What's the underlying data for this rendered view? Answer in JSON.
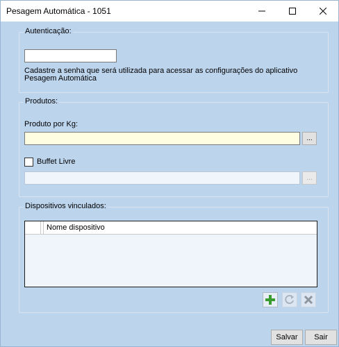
{
  "window": {
    "title": "Pesagem Automática - 1051"
  },
  "auth": {
    "group_label": "Autenticação:",
    "password_value": "",
    "hint": "Cadastre a senha que será utilizada para acessar as configurações do aplicativo Pesagem Automática"
  },
  "products": {
    "group_label": "Produtos:",
    "product_per_kg_label": "Produto por Kg:",
    "product_per_kg_value": "",
    "browse_label": "...",
    "buffet_label": "Buffet Livre",
    "buffet_checked": false,
    "buffet_value": "",
    "buffet_browse_label": "..."
  },
  "devices": {
    "group_label": "Dispositivos vinculados:",
    "columns": [
      "Nome dispositivo"
    ],
    "rows": []
  },
  "footer": {
    "save_label": "Salvar",
    "exit_label": "Sair"
  },
  "colors": {
    "form_background": "#bdd4ed",
    "required_field": "#fffde1",
    "add_icon": "#3a9b2f"
  }
}
